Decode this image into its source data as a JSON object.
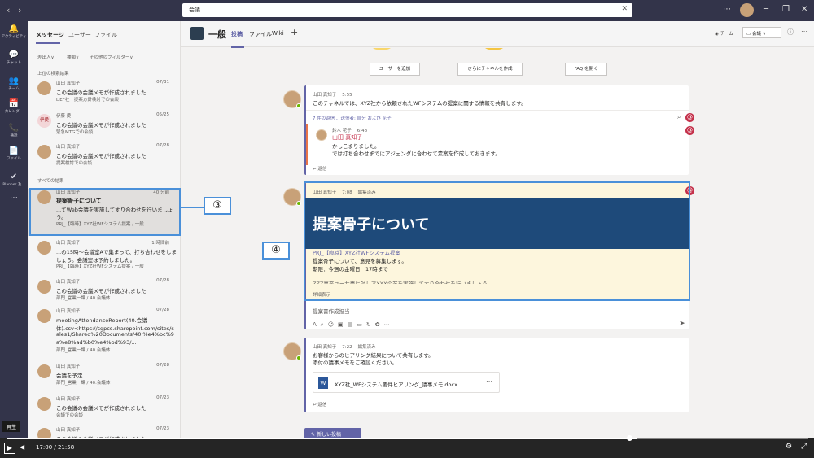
{
  "search": {
    "value": "会議"
  },
  "rail": [
    {
      "icon": "bell-icon",
      "label": "アクティビティ",
      "glyph": "🔔"
    },
    {
      "icon": "chat-icon",
      "label": "チャット",
      "glyph": "💬"
    },
    {
      "icon": "teams-icon",
      "label": "チーム",
      "glyph": "👥"
    },
    {
      "icon": "calendar-icon",
      "label": "カレンダー",
      "glyph": "📅"
    },
    {
      "icon": "call-icon",
      "label": "通話",
      "glyph": "📞"
    },
    {
      "icon": "files-icon",
      "label": "ファイル",
      "glyph": "📄"
    },
    {
      "icon": "planner-icon",
      "label": "Planner 及...",
      "glyph": "✔"
    },
    {
      "icon": "more-icon",
      "label": "",
      "glyph": "⋯"
    }
  ],
  "left": {
    "tabs": [
      "メッセージ",
      "ユーザー",
      "ファイル"
    ],
    "filters": [
      "差出人∨",
      "種類∨",
      "その他のフィルター∨"
    ],
    "top_section": "上位の検索結果",
    "all_section": "すべての結果",
    "top_results": [
      {
        "name": "山田 真知子",
        "date": "07/31",
        "line1": "この会議の会議メモが作成されました",
        "line2": "DEF社　提案方針検討での会談"
      },
      {
        "name": "伊藤 愛",
        "date": "05/25",
        "line1": "この会議の会議メモが作成されました",
        "line2": "緊急MTGでの会談",
        "initials": "伊愛"
      },
      {
        "name": "山田 真知子",
        "date": "07/28",
        "line1": "この会議の会議メモが作成されました",
        "line2": "提案検討での会談"
      }
    ],
    "all_results": [
      {
        "name": "山田 真知子",
        "date": "40 分前",
        "line1": "提案骨子について",
        "line2": "...てWeb会議を実施してすり合わせを行いましょ",
        "line3": "う。",
        "line4": "PRJ_【臨時】XYZ社WFシステム提案 / 一般"
      },
      {
        "name": "山田 真知子",
        "date": "1 時間前",
        "line1": "...の15時～会議室Aで集まって、打ち合わせをしま",
        "line2": "しょう。会議室は予約しました。",
        "line3": "PRJ_【臨時】XYZ社WFシステム提案 / 一般"
      },
      {
        "name": "山田 真知子",
        "date": "07/28",
        "line1": "この会議の会議メモが作成されました",
        "line2": "部門_営業一課 / 40.会議体"
      },
      {
        "name": "山田 真知子",
        "date": "07/28",
        "line1": "meetingAttendanceReport(40.会議",
        "line2": "体).csv<https://sgpcs.sharepoint.com/sites/s",
        "line3": "ales1/Shared%20Documents/40.%e4%bc%9",
        "line4": "a%e8%ad%b0%e4%bd%93/...",
        "line5": "部門_営業一課 / 40.会議体"
      },
      {
        "name": "山田 真知子",
        "date": "07/28",
        "line1": "会議を予定",
        "line2": "部門_営業一課 / 40.会議体"
      },
      {
        "name": "山田 真知子",
        "date": "07/23",
        "line1": "この会議の会議メモが作成されました",
        "line2": "会議での会談"
      },
      {
        "name": "山田 真知子",
        "date": "07/23",
        "line1": "この会議の会議メモが作成されました",
        "line2": ""
      }
    ]
  },
  "channel": {
    "name": "一般",
    "tabs": [
      "投稿",
      "ファイル",
      "Wiki"
    ],
    "add": "+",
    "team_label": "チーム",
    "meet_label": "会議"
  },
  "actions": [
    "ユーザーを追加",
    "さらにチャネルを作成",
    "FAQ を開く"
  ],
  "posts": {
    "p1": {
      "name": "山田 真知子",
      "time": "5:55",
      "body": "このチャネルでは、XYZ社から依頼されたWFシステムの提案に関する情報を共有します。",
      "replies": "7 件の返信 、送信者: 自分 および 花子"
    },
    "reply": {
      "name": "鈴木 花子",
      "time": "6:48",
      "mention": "山田 真知子",
      "body1": "かしこまりました。",
      "body2": "では打ち合わせまでにアジェンダに合わせて素案を作成しておきます。",
      "reply_label": "返信"
    },
    "p2": {
      "name": "山田 真知子",
      "time": "7:08",
      "edited": "編集済み",
      "banner": "提案骨子について",
      "line1": "PRJ_【臨時】XYZ社WFシステム提案",
      "line2": "提案骨子について、意見を募集します。",
      "line3": "期限：今週の金曜日　17時まで",
      "line4": "ZZZ事業ユーサ豊に対しアXXX企業を実施してすり合わせを行いましょう",
      "more": "詳細表示",
      "reply_placeholder": "提案書作成担当"
    },
    "p3": {
      "name": "山田 真知子",
      "time": "7:22",
      "edited": "編集済み",
      "body1": "お客様からのヒアリング結果について共有します。",
      "body2": "添付の議事メモをご確認ください。",
      "file": "XYZ社_WFシステム要件ヒアリング_議事メモ.docx",
      "reply_label": "返信"
    }
  },
  "newpost": "新しい投稿",
  "callouts": {
    "c3": "③",
    "c4": "④"
  },
  "player": {
    "time": "17:00 / 21:58",
    "progress": 0.786,
    "tooltip": "再生"
  },
  "colors": {
    "rail": "#33344a",
    "accent": "#6264a7",
    "callout": "#4a90d9",
    "banner": "#1e4a7a"
  }
}
